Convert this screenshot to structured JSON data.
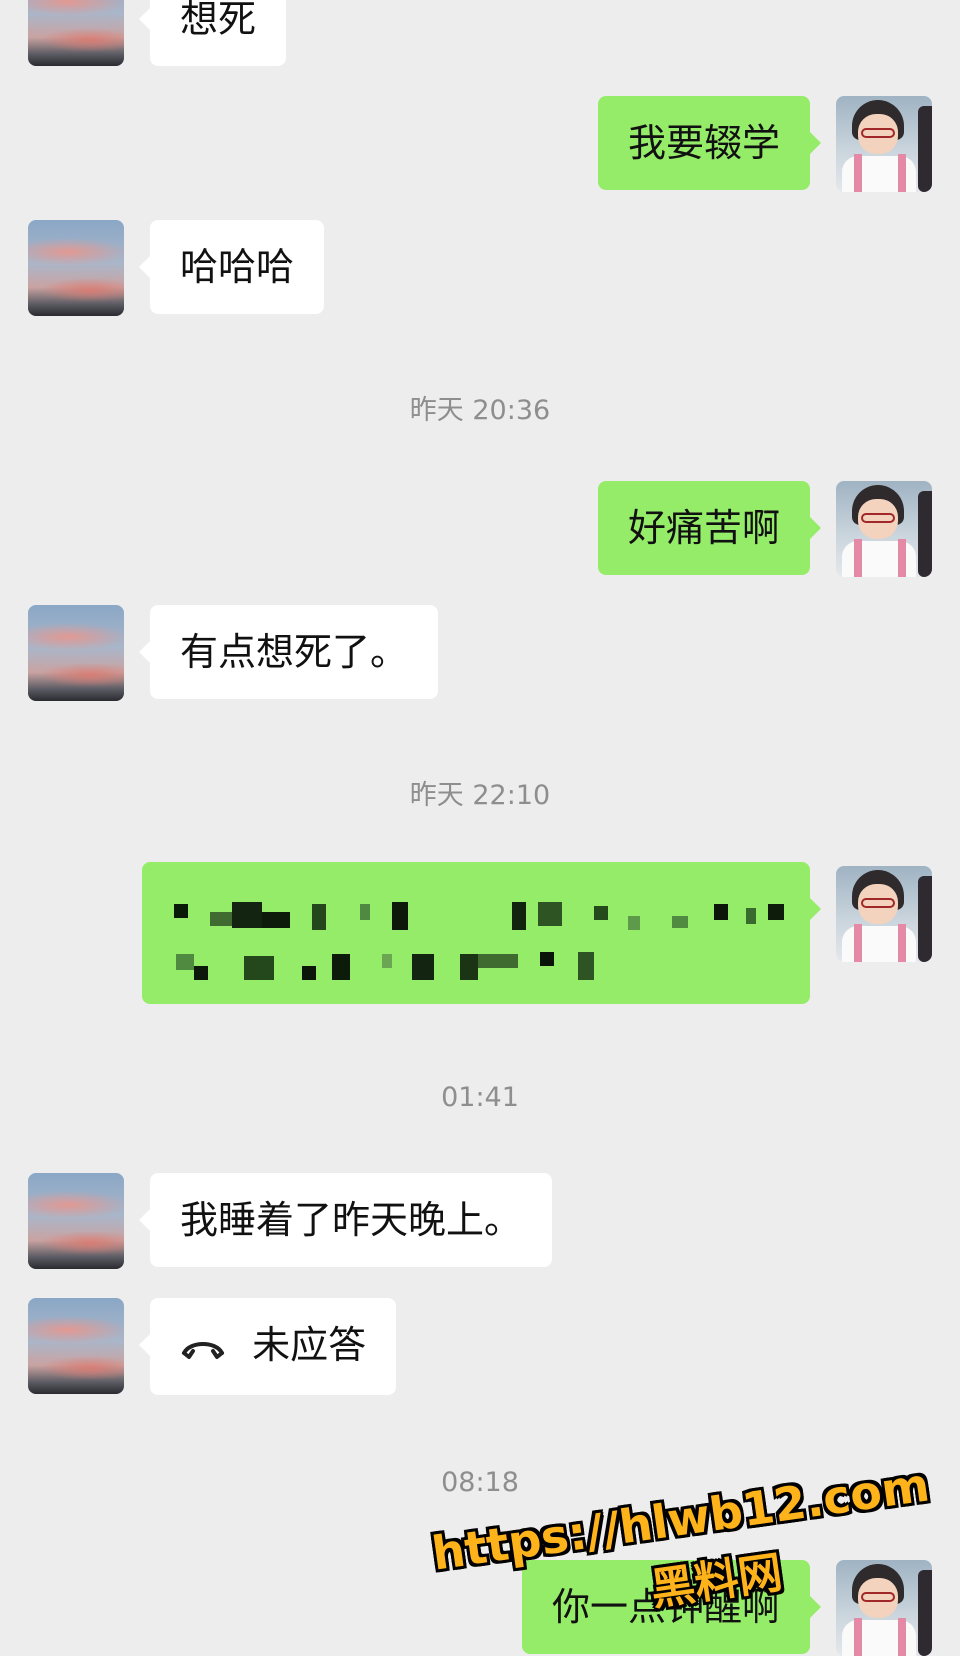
{
  "messages": {
    "m1": {
      "text": "想死"
    },
    "m2": {
      "text": "我要辍学"
    },
    "m3": {
      "text": "哈哈哈"
    },
    "t1": {
      "text": "昨天 20:36"
    },
    "m4": {
      "text": "好痛苦啊"
    },
    "m5": {
      "text": "有点想死了。"
    },
    "t2": {
      "text": "昨天 22:10"
    },
    "t3": {
      "text": "01:41"
    },
    "m7": {
      "text": "我睡着了昨天晚上。"
    },
    "m8": {
      "text": "未应答",
      "icon": "phone-hangup-icon"
    },
    "t4": {
      "text": "08:18"
    },
    "m9": {
      "text": "你一点钟醒啊"
    }
  },
  "watermark": {
    "url": "https://hlwb12.com",
    "name": "黑料网"
  },
  "colors": {
    "background": "#ededed",
    "incoming_bubble": "#ffffff",
    "outgoing_bubble": "#95ec69",
    "timestamp": "#8e8e8e",
    "watermark": "#ffb31a"
  }
}
